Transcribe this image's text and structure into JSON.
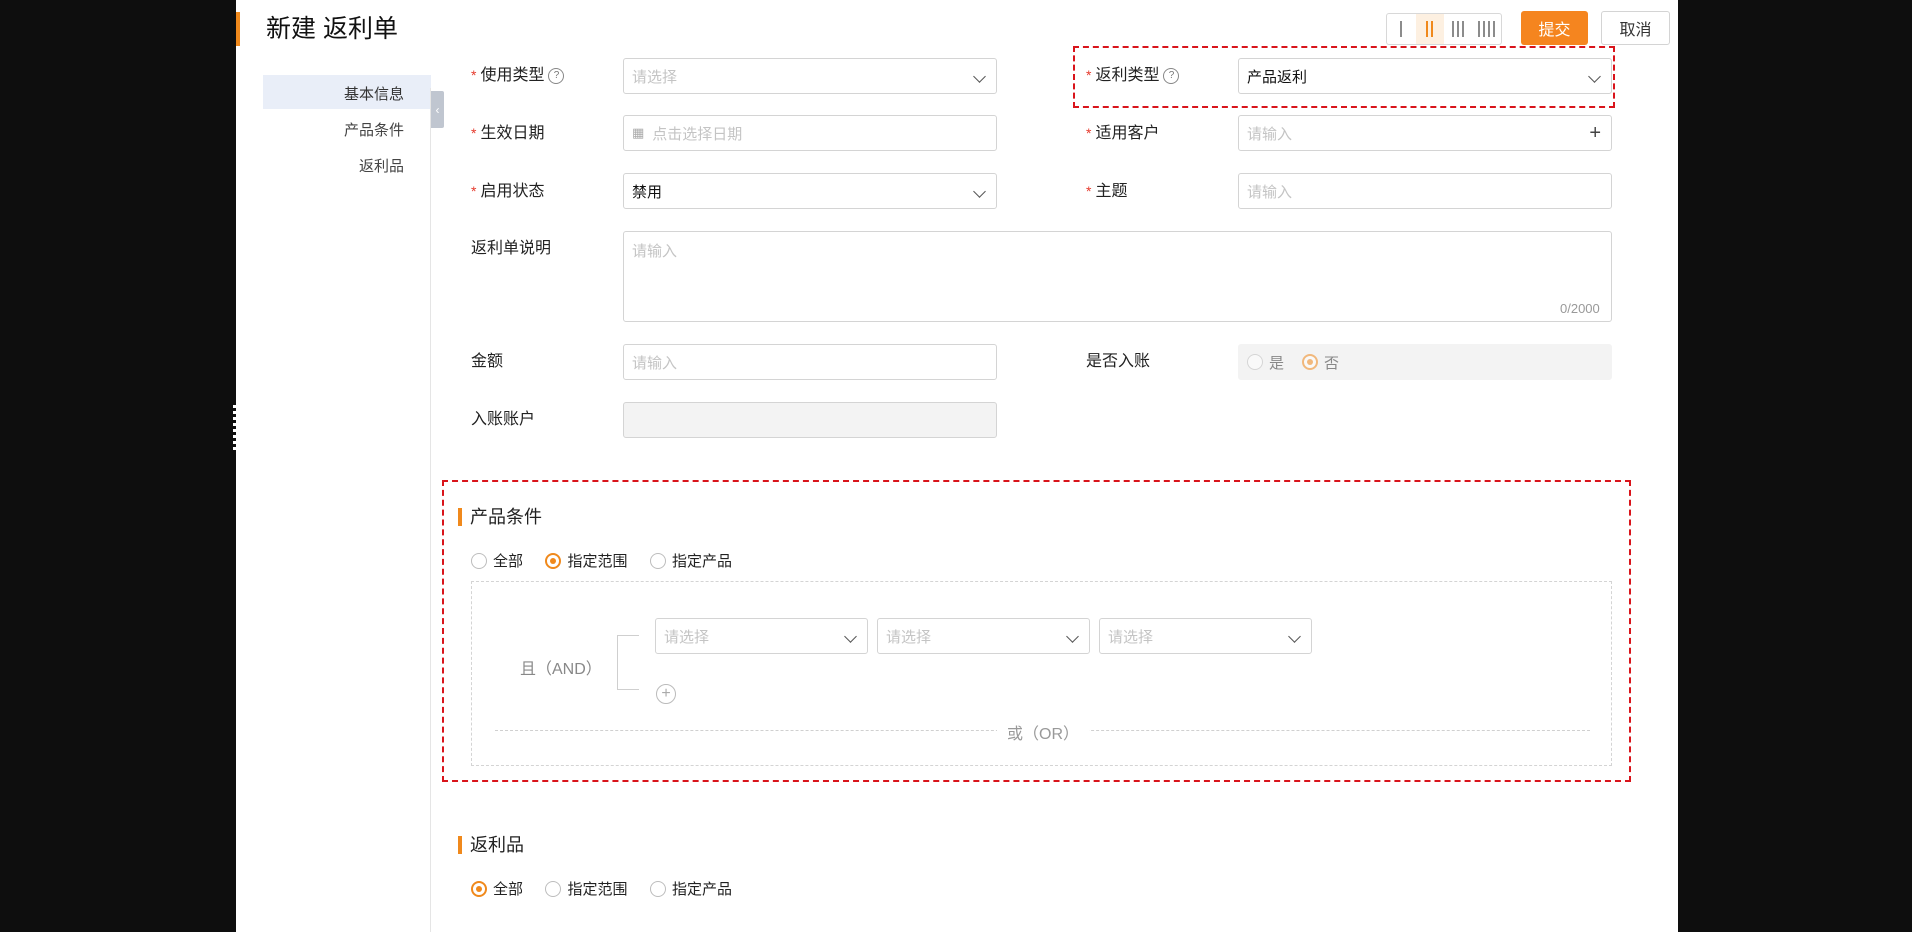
{
  "header": {
    "title": "新建 返利单",
    "submit_label": "提交",
    "cancel_label": "取消"
  },
  "sidebar": {
    "items": [
      {
        "label": "基本信息"
      },
      {
        "label": "产品条件"
      },
      {
        "label": "返利品"
      }
    ],
    "active": "基本信息"
  },
  "form": {
    "usage_type": {
      "label": "使用类型",
      "placeholder": "请选择"
    },
    "rebate_type": {
      "label": "返利类型",
      "value": "产品返利"
    },
    "effective_date": {
      "label": "生效日期",
      "placeholder": "点击选择日期"
    },
    "customer": {
      "label": "适用客户",
      "placeholder": "请输入"
    },
    "status": {
      "label": "启用状态",
      "value": "禁用"
    },
    "subject": {
      "label": "主题",
      "placeholder": "请输入"
    },
    "description": {
      "label": "返利单说明",
      "placeholder": "请输入",
      "counter": "0/2000"
    },
    "amount": {
      "label": "金额",
      "placeholder": "请输入"
    },
    "posted": {
      "label": "是否入账",
      "options": [
        "是",
        "否"
      ],
      "selected": "否"
    },
    "account": {
      "label": "入账账户"
    }
  },
  "product_conditions": {
    "title": "产品条件",
    "options": [
      "全部",
      "指定范围",
      "指定产品"
    ],
    "selected": "指定范围",
    "and_label": "且（AND）",
    "selects": [
      {
        "placeholder": "请选择"
      },
      {
        "placeholder": "请选择"
      },
      {
        "placeholder": "请选择"
      }
    ],
    "or_label": "或（OR）"
  },
  "rebate_products": {
    "title": "返利品",
    "options": [
      "全部",
      "指定范围",
      "指定产品"
    ],
    "selected": "全部"
  },
  "colors": {
    "accent": "#f0891c",
    "highlight": "#d9141b"
  }
}
